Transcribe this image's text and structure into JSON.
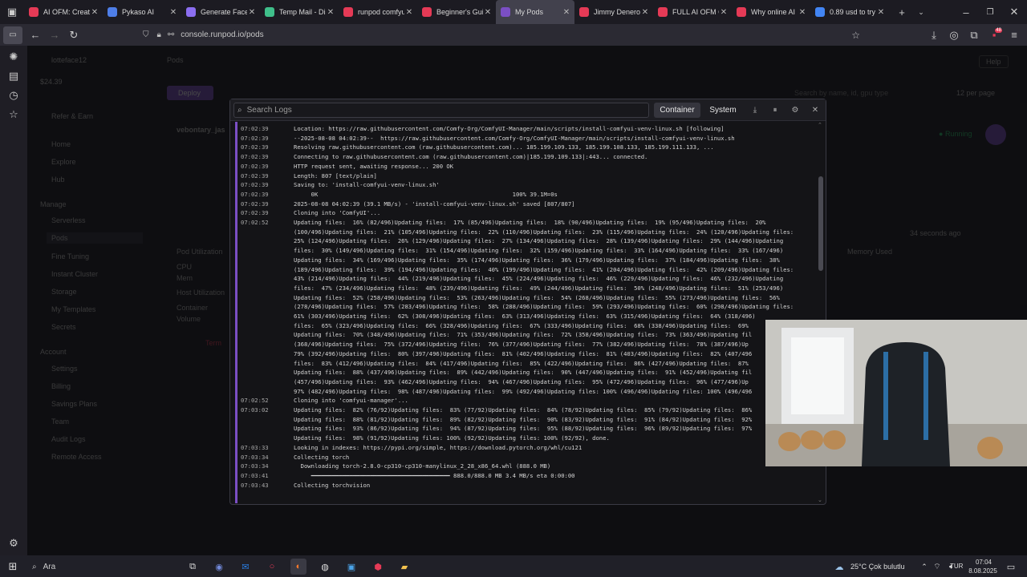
{
  "browser": {
    "tabs": [
      {
        "label": "AI OFM: Create a",
        "fav": "#e53a56"
      },
      {
        "label": "Pykaso AI",
        "fav": "#4e7ee8"
      },
      {
        "label": "Generate Face | ",
        "fav": "#8b6ef0"
      },
      {
        "label": "Temp Mail - Disp",
        "fav": "#3fbf8a"
      },
      {
        "label": "runpod comfyui",
        "fav": "#e53a56"
      },
      {
        "label": "Beginner's Guide",
        "fav": "#e53a56"
      },
      {
        "label": "My Pods",
        "fav": "#7b4fc4",
        "active": true
      },
      {
        "label": "Jimmy Denero - ",
        "fav": "#e53a56"
      },
      {
        "label": "FULL AI OFM CO",
        "fav": "#e53a56"
      },
      {
        "label": "Why online AI In",
        "fav": "#e53a56"
      },
      {
        "label": "0.89 usd to try - ",
        "fav": "#4285f4"
      }
    ],
    "url": "console.runpod.io/pods",
    "new_tab": "+",
    "ext_badge": "48"
  },
  "sidebar": {
    "account": "lotteface12",
    "balance": "$24.39",
    "items": [
      "Refer & Earn",
      "Home",
      "Explore",
      "Hub",
      "Manage",
      "Serverless",
      "Pods",
      "Fine Tuning",
      "Instant Cluster",
      "Storage",
      "My Templates",
      "Secrets",
      "Account",
      "Settings",
      "Billing",
      "Savings Plans",
      "Team",
      "Audit Logs",
      "Remote Access"
    ]
  },
  "main": {
    "page_title": "Pods",
    "deploy": "Deploy",
    "search_placeholder": "Search by name, id, gpu type",
    "per_page": "12 per page",
    "help": "Help",
    "pod_name": "vebontary_jas",
    "status": "Running",
    "pod_utilization": "Pod Utilization",
    "cpu": "CPU",
    "mem": "Mem",
    "host_util": "Host Utilization",
    "container": "Container",
    "volume": "Volume",
    "updated": "34 seconds ago",
    "memory_used": "Memory Used",
    "terminate": "Term"
  },
  "logs": {
    "search_placeholder": "Search Logs",
    "btn_container": "Container",
    "btn_system": "System",
    "lines": [
      {
        "t": "07:02:39",
        "x": "Location: https://raw.githubusercontent.com/Comfy-Org/ComfyUI-Manager/main/scripts/install-comfyui-venv-linux.sh [following]"
      },
      {
        "t": "07:02:39",
        "x": "--2025-08-08 04:02:39--  https://raw.githubusercontent.com/Comfy-Org/ComfyUI-Manager/main/scripts/install-comfyui-venv-linux.sh"
      },
      {
        "t": "07:02:39",
        "x": "Resolving raw.githubusercontent.com (raw.githubusercontent.com)... 185.199.109.133, 185.199.108.133, 185.199.111.133, ..."
      },
      {
        "t": "07:02:39",
        "x": "Connecting to raw.githubusercontent.com (raw.githubusercontent.com)|185.199.109.133|:443... connected."
      },
      {
        "t": "07:02:39",
        "x": "HTTP request sent, awaiting response... 200 OK"
      },
      {
        "t": "07:02:39",
        "x": "Length: 807 [text/plain]"
      },
      {
        "t": "07:02:39",
        "x": "Saving to: 'install-comfyui-venv-linux.sh'"
      },
      {
        "t": "07:02:39",
        "x": "     0K                                                        100% 39.1M=0s"
      },
      {
        "t": "07:02:39",
        "x": "2025-08-08 04:02:39 (39.1 MB/s) - 'install-comfyui-venv-linux.sh' saved [807/807]"
      },
      {
        "t": "07:02:39",
        "x": "Cloning into 'ComfyUI'..."
      },
      {
        "t": "07:02:52",
        "x": "Updating files:  16% (82/496)Updating files:  17% (85/496)Updating files:  18% (90/496)Updating files:  19% (95/496)Updating files:  20%"
      },
      {
        "t": "",
        "x": "(100/496)Updating files:  21% (105/496)Updating files:  22% (110/496)Updating files:  23% (115/496)Updating files:  24% (120/496)Updating files:"
      },
      {
        "t": "",
        "x": "25% (124/496)Updating files:  26% (129/496)Updating files:  27% (134/496)Updating files:  28% (139/496)Updating files:  29% (144/496)Updating"
      },
      {
        "t": "",
        "x": "files:  30% (149/496)Updating files:  31% (154/496)Updating files:  32% (159/496)Updating files:  33% (164/496)Updating files:  33% (167/496)"
      },
      {
        "t": "",
        "x": "Updating files:  34% (169/496)Updating files:  35% (174/496)Updating files:  36% (179/496)Updating files:  37% (184/496)Updating files:  38%"
      },
      {
        "t": "",
        "x": "(189/496)Updating files:  39% (194/496)Updating files:  40% (199/496)Updating files:  41% (204/496)Updating files:  42% (209/496)Updating files:"
      },
      {
        "t": "",
        "x": "43% (214/496)Updating files:  44% (219/496)Updating files:  45% (224/496)Updating files:  46% (229/496)Updating files:  46% (232/496)Updating"
      },
      {
        "t": "",
        "x": "files:  47% (234/496)Updating files:  48% (239/496)Updating files:  49% (244/496)Updating files:  50% (248/496)Updating files:  51% (253/496)"
      },
      {
        "t": "",
        "x": "Updating files:  52% (258/496)Updating files:  53% (263/496)Updating files:  54% (268/496)Updating files:  55% (273/496)Updating files:  56%"
      },
      {
        "t": "",
        "x": "(278/496)Updating files:  57% (283/496)Updating files:  58% (288/496)Updating files:  59% (293/496)Updating files:  60% (298/496)Updating files:"
      },
      {
        "t": "",
        "x": "61% (303/496)Updating files:  62% (308/496)Updating files:  63% (313/496)Updating files:  63% (315/496)Updating files:  64% (318/496)"
      },
      {
        "t": "",
        "x": "files:  65% (323/496)Updating files:  66% (328/496)Updating files:  67% (333/496)Updating files:  68% (338/496)Updating files:  69%"
      },
      {
        "t": "",
        "x": "Updating files:  70% (348/496)Updating files:  71% (353/496)Updating files:  72% (358/496)Updating files:  73% (363/496)Updating fil"
      },
      {
        "t": "",
        "x": "(368/496)Updating files:  75% (372/496)Updating files:  76% (377/496)Updating files:  77% (382/496)Updating files:  78% (387/496)Up"
      },
      {
        "t": "",
        "x": "79% (392/496)Updating files:  80% (397/496)Updating files:  81% (402/496)Updating files:  81% (403/496)Updating files:  82% (407/496"
      },
      {
        "t": "",
        "x": "files:  83% (412/496)Updating files:  84% (417/496)Updating files:  85% (422/496)Updating files:  86% (427/496)Updating files:  87%"
      },
      {
        "t": "",
        "x": "Updating files:  88% (437/496)Updating files:  89% (442/496)Updating files:  90% (447/496)Updating files:  91% (452/496)Updating fil"
      },
      {
        "t": "",
        "x": "(457/496)Updating files:  93% (462/496)Updating files:  94% (467/496)Updating files:  95% (472/496)Updating files:  96% (477/496)Up"
      },
      {
        "t": "",
        "x": "97% (482/496)Updating files:  98% (487/496)Updating files:  99% (492/496)Updating files: 100% (496/496)Updating files: 100% (496/496"
      },
      {
        "t": "07:02:52",
        "x": "Cloning into 'comfyui-manager'..."
      },
      {
        "t": "07:03:02",
        "x": "Updating files:  82% (76/92)Updating files:  83% (77/92)Updating files:  84% (78/92)Updating files:  85% (79/92)Updating files:  86%"
      },
      {
        "t": "",
        "x": "Updating files:  88% (81/92)Updating files:  89% (82/92)Updating files:  90% (83/92)Updating files:  91% (84/92)Updating files:  92%"
      },
      {
        "t": "",
        "x": "Updating files:  93% (86/92)Updating files:  94% (87/92)Updating files:  95% (88/92)Updating files:  96% (89/92)Updating files:  97%"
      },
      {
        "t": "",
        "x": "Updating files:  98% (91/92)Updating files: 100% (92/92)Updating files: 100% (92/92), done."
      },
      {
        "t": "07:03:33",
        "x": "Looking in indexes: https://pypi.org/simple, https://download.pytorch.org/whl/cu121"
      },
      {
        "t": "07:03:34",
        "x": "Collecting torch"
      },
      {
        "t": "07:03:34",
        "x": "  Downloading torch-2.8.0-cp310-cp310-manylinux_2_28_x86_64.whl (888.0 MB)"
      },
      {
        "t": "07:03:41",
        "x": "     ━━━━━━━━━━━━━━━━━━━━━━━━━━━━━━━━━━━━━━━━ 888.0/888.0 MB 3.4 MB/s eta 0:00:00"
      },
      {
        "t": "07:03:43",
        "x": "Collecting torchvision"
      }
    ]
  },
  "taskbar": {
    "search": "Ara",
    "weather": "25°C  Çok bulutlu",
    "lang": "TUR",
    "time": "07:04",
    "date": "8.08.2025"
  },
  "colors": {
    "accent": "#7b4fc4",
    "running": "#27c46b"
  }
}
